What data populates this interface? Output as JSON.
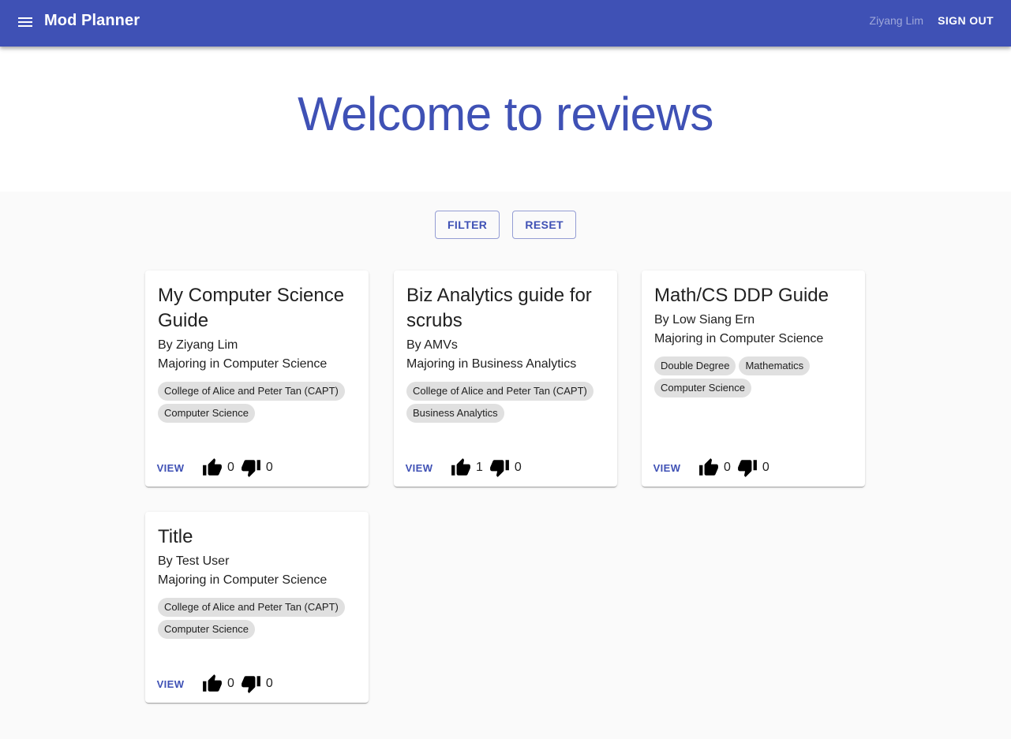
{
  "header": {
    "title": "Mod Planner",
    "user": "Ziyang Lim",
    "sign_out": "SIGN OUT",
    "menu_icon": "menu-icon"
  },
  "hero": {
    "title": "Welcome to reviews"
  },
  "controls": {
    "filter": "FILTER",
    "reset": "RESET"
  },
  "colors": {
    "primary": "#3f51b5",
    "background": "#fafafa",
    "chip": "#e0e0e0"
  },
  "reviews": [
    {
      "title": "My Computer Science Guide",
      "author": "By Ziyang Lim",
      "major": "Majoring in Computer Science",
      "tags": [
        "College of Alice and Peter Tan (CAPT)",
        "Computer Science"
      ],
      "view": "VIEW",
      "likes": "0",
      "dislikes": "0"
    },
    {
      "title": "Biz Analytics guide for scrubs",
      "author": "By AMVs",
      "major": "Majoring in Business Analytics",
      "tags": [
        "College of Alice and Peter Tan (CAPT)",
        "Business Analytics"
      ],
      "view": "VIEW",
      "likes": "1",
      "dislikes": "0"
    },
    {
      "title": "Math/CS DDP Guide",
      "author": "By Low Siang Ern",
      "major": "Majoring in Computer Science",
      "tags": [
        "Double Degree",
        "Mathematics",
        "Computer Science"
      ],
      "view": "VIEW",
      "likes": "0",
      "dislikes": "0"
    },
    {
      "title": "Title",
      "author": "By Test User",
      "major": "Majoring in Computer Science",
      "tags": [
        "College of Alice and Peter Tan (CAPT)",
        "Computer Science"
      ],
      "view": "VIEW",
      "likes": "0",
      "dislikes": "0"
    }
  ]
}
